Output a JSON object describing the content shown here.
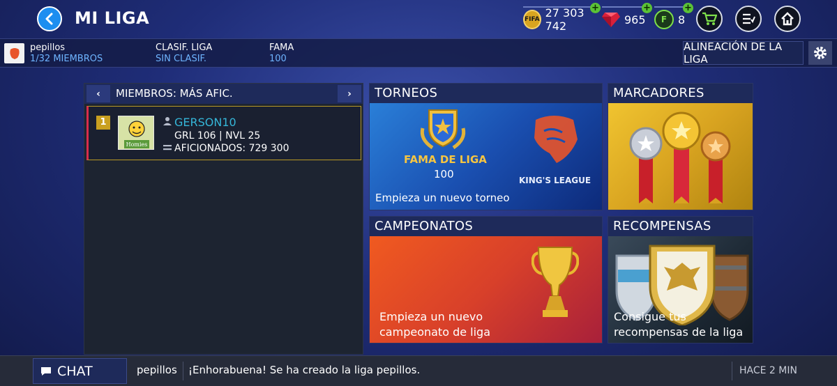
{
  "header": {
    "title": "MI LIGA",
    "coins": "27 303 742",
    "coins_icon": "FIFA",
    "gems": "965",
    "fifa_points": "8",
    "fifa_points_icon": "F"
  },
  "league": {
    "name": "pepillos",
    "members": "1/32 MIEMBROS",
    "rank_label": "CLASIF. LIGA",
    "rank_value": "SIN CLASIF.",
    "fame_label": "FAMA",
    "fame_value": "100",
    "lineup_button": "ALINEACIÓN DE LA LIGA"
  },
  "members_panel": {
    "title": "MIEMBROS: MÁS AFIC.",
    "prev_glyph": "‹",
    "next_glyph": "›",
    "rows": [
      {
        "rank": "1",
        "name": "GERSON10",
        "stats": "GRL 106 | NVL 25",
        "fans": "AFICIONADOS: 729 300",
        "avatar_text": "Homies"
      }
    ]
  },
  "cards": {
    "torneos": {
      "title": "TORNEOS",
      "fame_label": "FAMA DE LIGA",
      "fame_value": "100",
      "partner": "KING'S LEAGUE",
      "cta": "Empieza un nuevo torneo"
    },
    "marcadores": {
      "title": "MARCADORES"
    },
    "campeonatos": {
      "title": "CAMPEONATOS",
      "cta_line1": "Empieza un nuevo",
      "cta_line2": "campeonato de liga"
    },
    "recompensas": {
      "title": "RECOMPENSAS",
      "cta_line1": "Consigue tus",
      "cta_line2": "recompensas de la liga"
    }
  },
  "chat": {
    "button_label": "CHAT",
    "user": "pepillos",
    "message": "¡Enhorabuena! Se ha creado la liga pepillos.",
    "time": "HACE 2 MIN"
  },
  "colors": {
    "accent_blue": "#1d8ef0",
    "member_name": "#35b6d8",
    "info_value": "#6eb4ff",
    "gold_badge": "#c9a020"
  }
}
